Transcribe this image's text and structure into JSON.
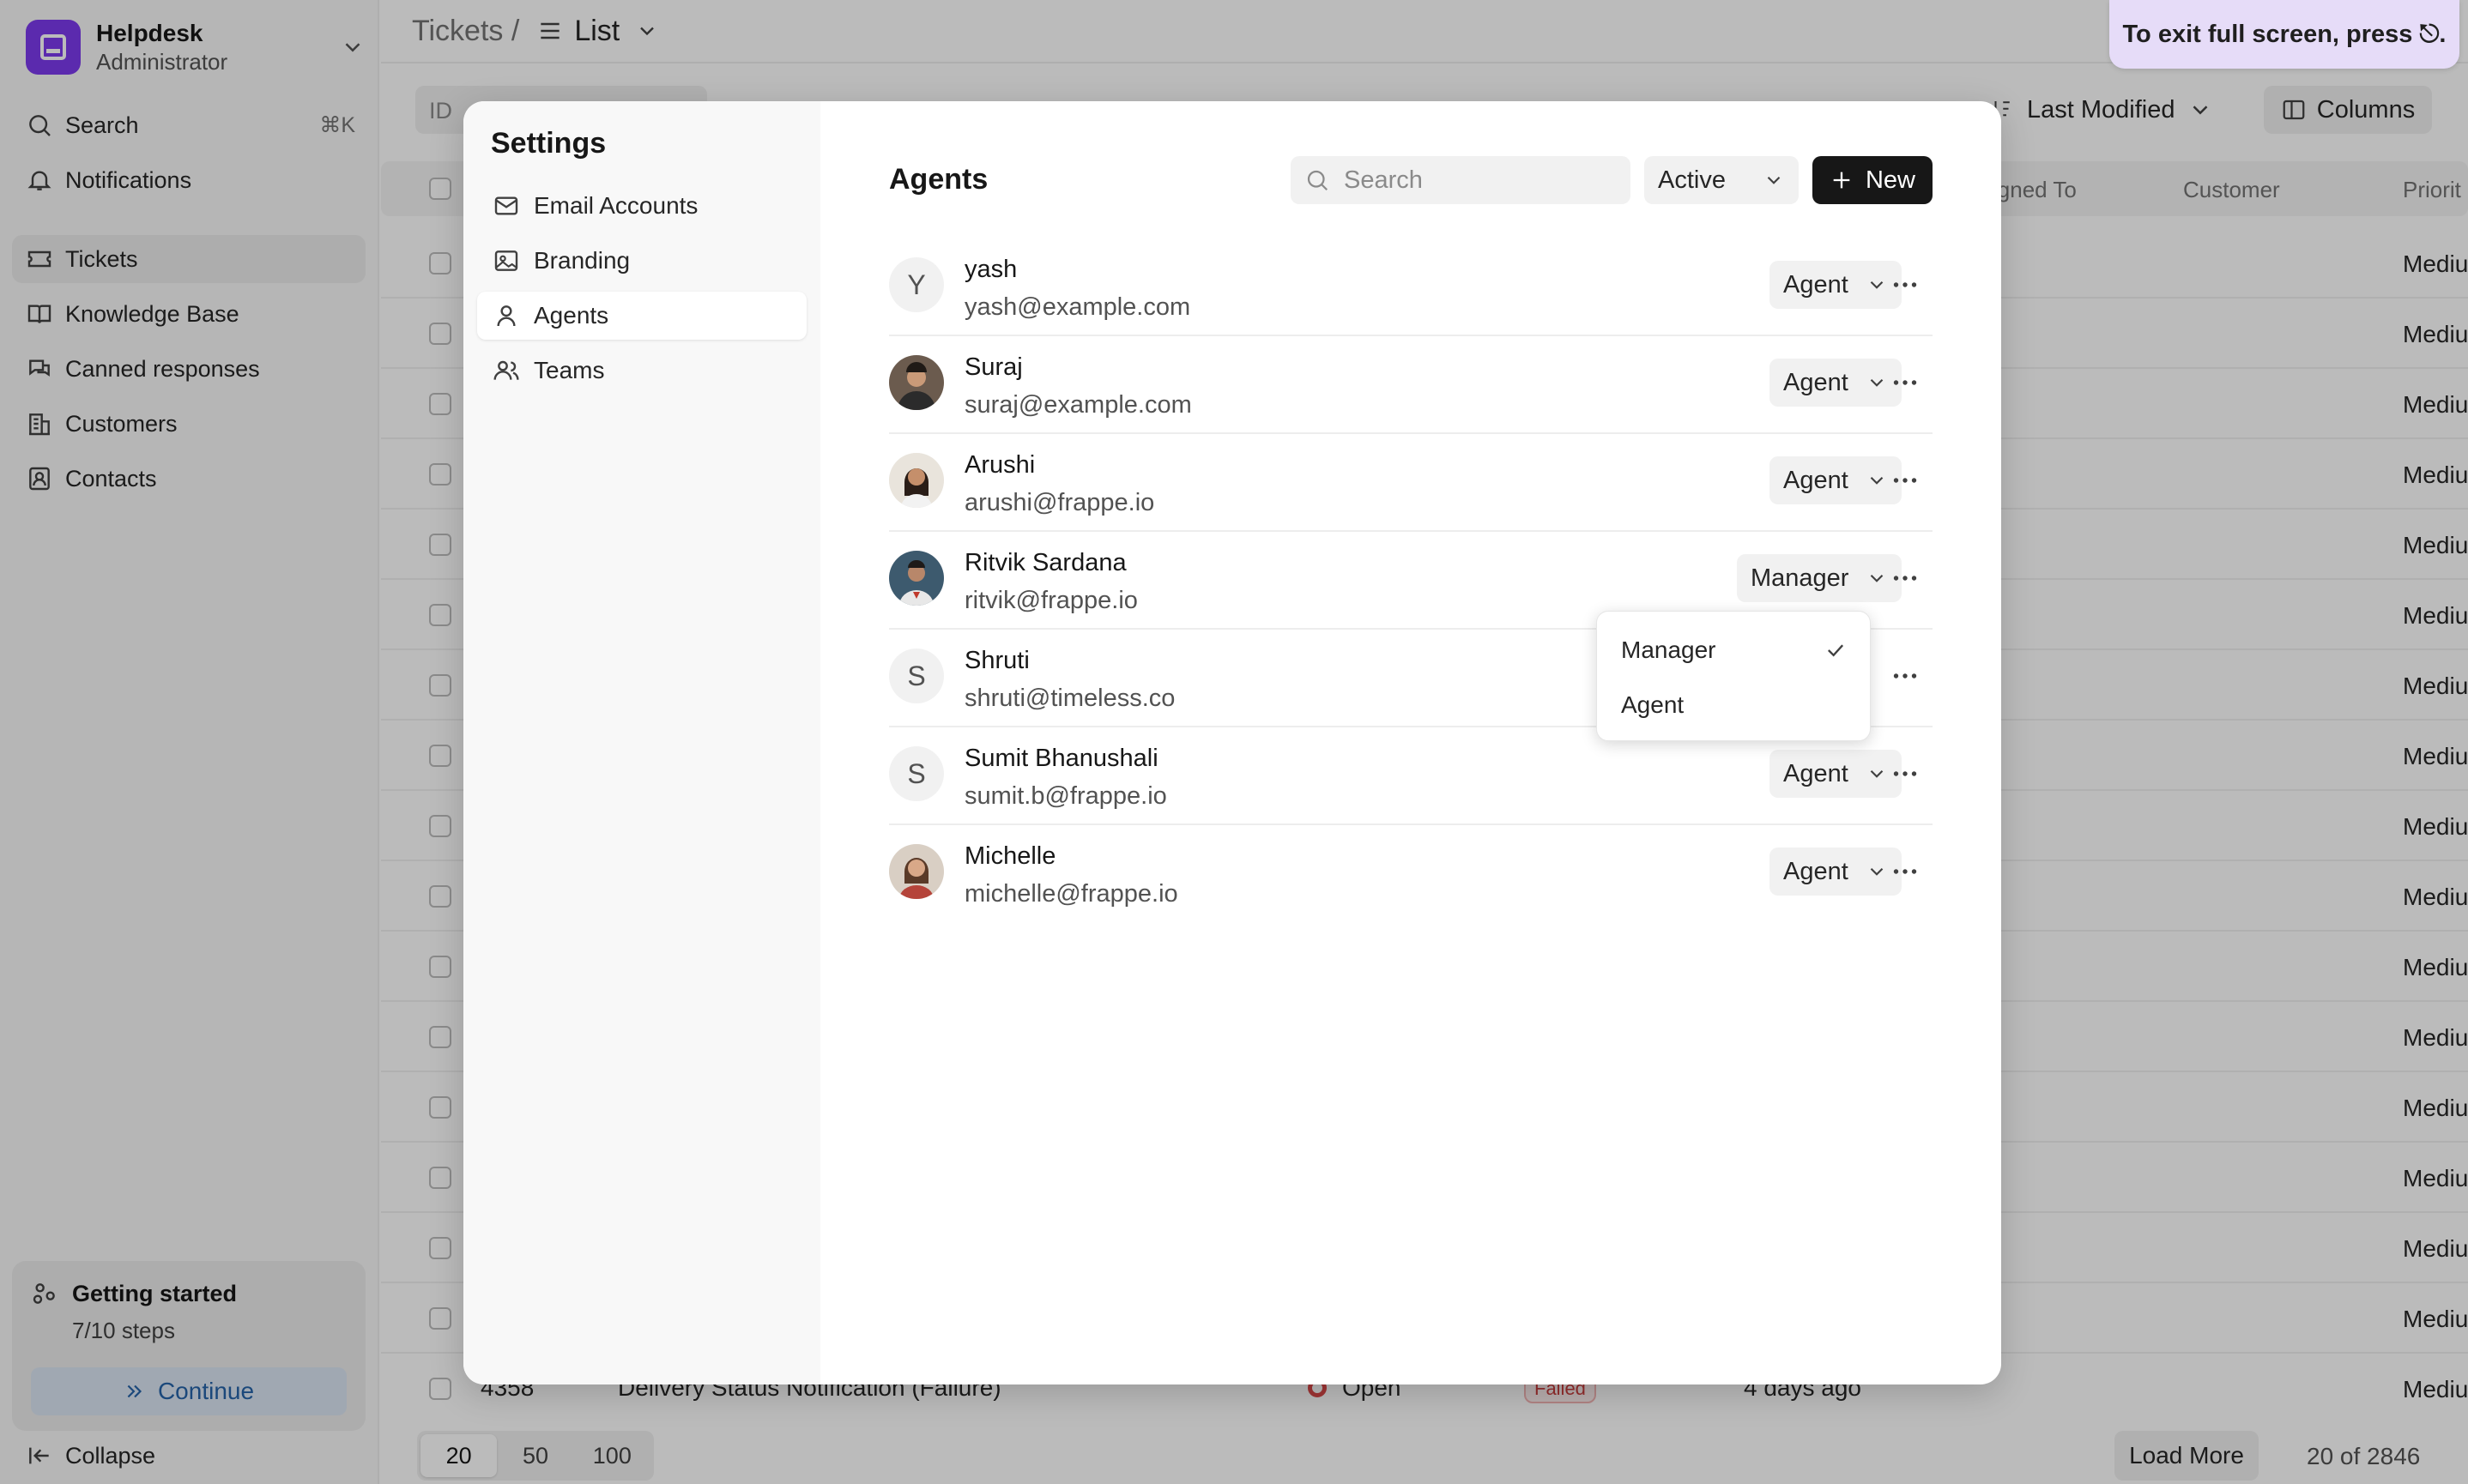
{
  "sidebar": {
    "brand": {
      "name": "Helpdesk",
      "role": "Administrator"
    },
    "search_label": "Search",
    "search_shortcut": "⌘K",
    "items": [
      {
        "label": "Notifications"
      },
      {
        "label": "Tickets"
      },
      {
        "label": "Knowledge Base"
      },
      {
        "label": "Canned responses"
      },
      {
        "label": "Customers"
      },
      {
        "label": "Contacts"
      }
    ],
    "getting_started": {
      "title": "Getting started",
      "steps": "7/10 steps",
      "button": "Continue"
    },
    "collapse_label": "Collapse"
  },
  "topbar": {
    "breadcrumb_root": "Tickets /",
    "view_label": "List"
  },
  "fullscreen_toast": "To exit full screen, press ⎋.",
  "filters": {
    "id_placeholder": "ID",
    "sort_label": "Last Modified",
    "columns_label": "Columns"
  },
  "table": {
    "headers": {
      "assigned": "igned To",
      "customer": "Customer",
      "priority": "Priorit"
    },
    "priority_value": "Mediu",
    "last_row": {
      "id": "4358",
      "subject": "Delivery Status Notification (Failure)",
      "status": "Open",
      "badge": "Failed",
      "time": "4 days ago"
    }
  },
  "footer": {
    "page_sizes": [
      "20",
      "50",
      "100"
    ],
    "load_more": "Load More",
    "count": "20 of 2846"
  },
  "settings": {
    "title": "Settings",
    "nav": [
      {
        "label": "Email Accounts"
      },
      {
        "label": "Branding"
      },
      {
        "label": "Agents"
      },
      {
        "label": "Teams"
      }
    ],
    "agents": {
      "heading": "Agents",
      "search_placeholder": "Search",
      "status_filter": "Active",
      "new_label": "New",
      "list": [
        {
          "name": "yash",
          "email": "yash@example.com",
          "role": "Agent",
          "initial": "Y"
        },
        {
          "name": "Suraj",
          "email": "suraj@example.com",
          "role": "Agent",
          "initial": ""
        },
        {
          "name": "Arushi",
          "email": "arushi@frappe.io",
          "role": "Agent",
          "initial": ""
        },
        {
          "name": "Ritvik Sardana",
          "email": "ritvik@frappe.io",
          "role": "Manager",
          "initial": ""
        },
        {
          "name": "Shruti",
          "email": "shruti@timeless.co",
          "role": "",
          "initial": "S"
        },
        {
          "name": "Sumit Bhanushali",
          "email": "sumit.b@frappe.io",
          "role": "Agent",
          "initial": "S"
        },
        {
          "name": "Michelle",
          "email": "michelle@frappe.io",
          "role": "Agent",
          "initial": ""
        }
      ]
    },
    "role_menu": {
      "options": [
        "Manager",
        "Agent"
      ],
      "selected": "Manager"
    }
  },
  "colors": {
    "brand": "#7c3aed",
    "primary_button": "#171717",
    "toast_bg": "#e6dcf8",
    "continue_bg": "#dbe6f3"
  }
}
